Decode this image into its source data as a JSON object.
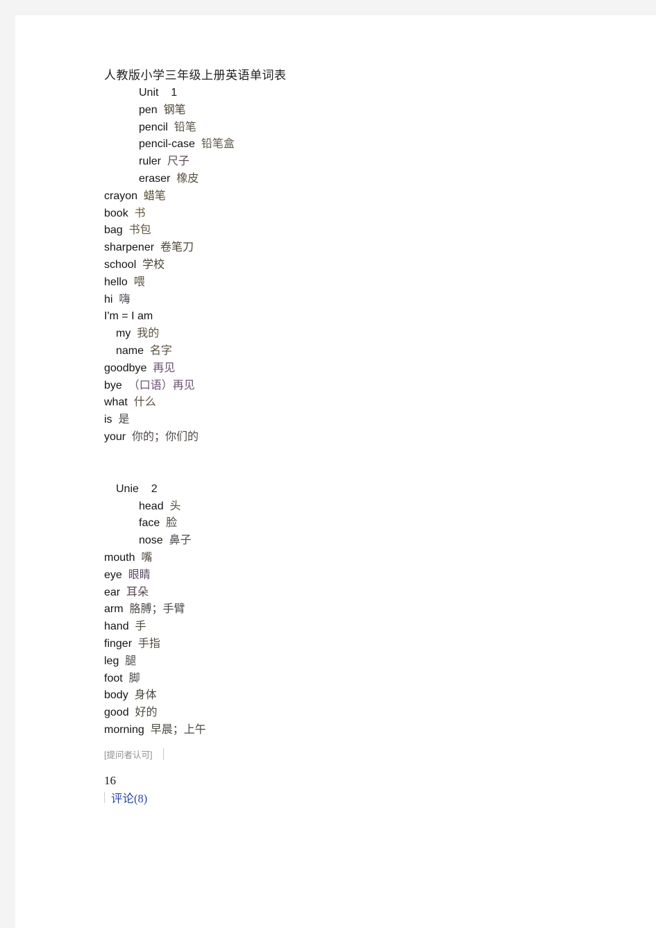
{
  "document": {
    "title": "人教版小学三年级上册英语单词表",
    "sections": [
      {
        "heading": "Unit    1",
        "heading_indent": 3,
        "entries": [
          {
            "en": "pen",
            "zh": "钢笔",
            "indent": 3,
            "zh_color": "#4a4030"
          },
          {
            "en": "pencil",
            "zh": "铅笔",
            "indent": 3,
            "zh_color": "#5a5448"
          },
          {
            "en": "pencil-case",
            "zh": "铅笔盒",
            "indent": 3,
            "zh_color": "#5e5748"
          },
          {
            "en": "ruler",
            "zh": "尺子",
            "indent": 3,
            "zh_color": "#5a4c56"
          },
          {
            "en": "eraser",
            "zh": "橡皮",
            "indent": 3,
            "zh_color": "#5c5243"
          },
          {
            "en": "crayon",
            "zh": "蜡笔",
            "indent": 0,
            "zh_color": "#584d35"
          },
          {
            "en": "book",
            "zh": "书",
            "indent": 0,
            "zh_color": "#6b5a3a"
          },
          {
            "en": "bag",
            "zh": "书包",
            "indent": 0,
            "zh_color": "#60573f"
          },
          {
            "en": "sharpener",
            "zh": "卷笔刀",
            "indent": 0,
            "zh_color": "#4e4636"
          },
          {
            "en": "school",
            "zh": "学校",
            "indent": 0,
            "zh_color": "#4a4438"
          },
          {
            "en": "hello",
            "zh": "喂",
            "indent": 0,
            "zh_color": "#5a5140"
          },
          {
            "en": "hi",
            "zh": "嗨",
            "indent": 0,
            "zh_color": "#4b4a55"
          },
          {
            "en": "I'm = I am",
            "zh": "",
            "indent": 0,
            "zh_color": "#3a3a3a"
          },
          {
            "en": "my",
            "zh": "我的",
            "indent": 1,
            "zh_color": "#5c5344"
          },
          {
            "en": "name",
            "zh": "名字",
            "indent": 1,
            "zh_color": "#5a5043"
          },
          {
            "en": "goodbye",
            "zh": "再见",
            "indent": 0,
            "zh_color": "#6b5070"
          },
          {
            "en": "bye",
            "zh": "（口语）再见",
            "indent": 0,
            "zh_color": "#6a5272"
          },
          {
            "en": "what",
            "zh": "什么",
            "indent": 0,
            "zh_color": "#554c3e"
          },
          {
            "en": "is",
            "zh": "是",
            "indent": 0,
            "zh_color": "#4c4a50"
          },
          {
            "en": "your",
            "zh": "你的；你们的",
            "indent": 0,
            "zh_color": "#4f4a48"
          }
        ]
      },
      {
        "heading": "Unie    2",
        "heading_indent": 1,
        "entries": [
          {
            "en": "head",
            "zh": "头",
            "indent": 3,
            "zh_color": "#55503f"
          },
          {
            "en": "face",
            "zh": "脸",
            "indent": 3,
            "zh_color": "#4c4a46"
          },
          {
            "en": "nose",
            "zh": "鼻子",
            "indent": 3,
            "zh_color": "#4a4a52"
          },
          {
            "en": "mouth",
            "zh": "嘴",
            "indent": 0,
            "zh_color": "#534e44"
          },
          {
            "en": "eye",
            "zh": "眼睛",
            "indent": 0,
            "zh_color": "#5b4a66"
          },
          {
            "en": "ear",
            "zh": "耳朵",
            "indent": 0,
            "zh_color": "#55484a"
          },
          {
            "en": "arm",
            "zh": "胳膊；手臂",
            "indent": 0,
            "zh_color": "#4d4a48"
          },
          {
            "en": "hand",
            "zh": "手",
            "indent": 0,
            "zh_color": "#52503f"
          },
          {
            "en": "finger",
            "zh": "手指",
            "indent": 0,
            "zh_color": "#54503f"
          },
          {
            "en": "leg",
            "zh": "腿",
            "indent": 0,
            "zh_color": "#4e4c52"
          },
          {
            "en": "foot",
            "zh": "脚",
            "indent": 0,
            "zh_color": "#4e4b48"
          },
          {
            "en": "body",
            "zh": "身体",
            "indent": 0,
            "zh_color": "#4a4944"
          },
          {
            "en": "good",
            "zh": "好的",
            "indent": 0,
            "zh_color": "#4d4a3f"
          },
          {
            "en": "morning",
            "zh": "早晨；上午",
            "indent": 0,
            "zh_color": "#4c4a42"
          }
        ]
      }
    ]
  },
  "footer": {
    "approved_label": "[提问者认可]",
    "vote_count": "16",
    "comment_label": "评论(8)",
    "link_color": "#2c46a4",
    "approved_color": "#8d8d8d"
  }
}
